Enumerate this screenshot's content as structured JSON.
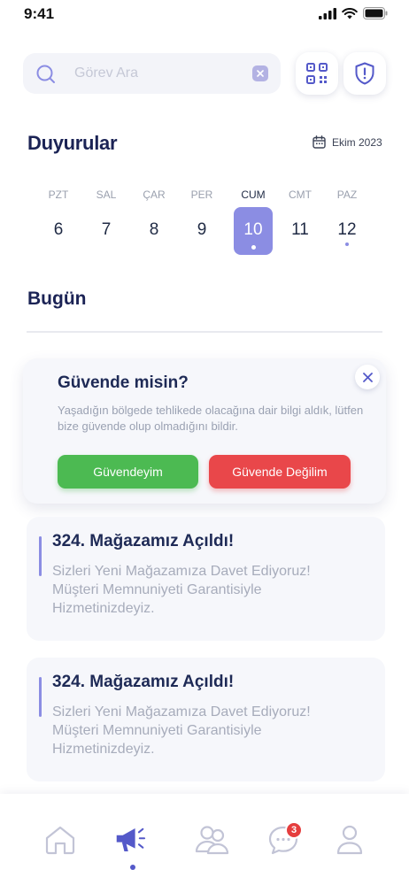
{
  "status_bar": {
    "time": "9:41"
  },
  "search": {
    "placeholder": "Görev Ara",
    "value": ""
  },
  "header": {
    "title": "Duyurular",
    "month_label": "Ekim 2023"
  },
  "week": {
    "days": [
      {
        "name": "PZT",
        "number": "6"
      },
      {
        "name": "SAL",
        "number": "7"
      },
      {
        "name": "ÇAR",
        "number": "8"
      },
      {
        "name": "PER",
        "number": "9"
      },
      {
        "name": "CUM",
        "number": "10",
        "selected": true,
        "has_event": true
      },
      {
        "name": "CMT",
        "number": "11"
      },
      {
        "name": "PAZ",
        "number": "12",
        "has_event": true
      }
    ]
  },
  "section": {
    "today_label": "Bugün"
  },
  "safety_card": {
    "title": "Güvende misin?",
    "message": "Yaşadığın bölgede tehlikede olacağına dair bilgi aldık, lütfen bize güvende olup olmadığını bildir.",
    "safe_button": "Güvendeyim",
    "unsafe_button": "Güvende Değilim"
  },
  "announcements": [
    {
      "title": "324. Mağazamız Açıldı!",
      "body": "Sizleri Yeni Mağazamıza Davet Ediyoruz! Müşteri Memnuniyeti Garantisiyle Hizmetinizdeyiz."
    },
    {
      "title": "324. Mağazamız Açıldı!",
      "body": "Sizleri Yeni Mağazamıza Davet Ediyoruz! Müşteri Memnuniyeti Garantisiyle Hizmetinizdeyiz."
    }
  ],
  "bottom_nav": {
    "items": [
      "home-icon",
      "megaphone-icon",
      "users-icon",
      "chat-icon",
      "profile-icon"
    ],
    "active": "megaphone-icon",
    "chat_badge": "3"
  },
  "colors": {
    "accent": "#8b8de3",
    "nav_active": "#5459c9",
    "title": "#1b2355",
    "safe": "#4cba52",
    "unsafe": "#e9474a",
    "badge": "#e53e3e"
  }
}
